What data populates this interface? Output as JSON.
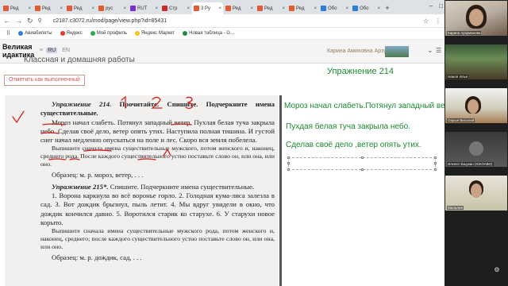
{
  "browser": {
    "tabs": [
      {
        "label": "Ред",
        "color": "#e25b35",
        "active": false
      },
      {
        "label": "Ред",
        "color": "#e25b35",
        "active": false
      },
      {
        "label": "Ред",
        "color": "#e25b35",
        "active": false
      },
      {
        "label": "рус",
        "color": "#e25b35",
        "active": false
      },
      {
        "label": "RUT",
        "color": "#7a2ecf",
        "active": false
      },
      {
        "label": "Стр",
        "color": "#cc2b2b",
        "active": false
      },
      {
        "label": "3 Ру",
        "color": "#e25b35",
        "active": true
      },
      {
        "label": "Ред",
        "color": "#e25b35",
        "active": false
      },
      {
        "label": "Ред",
        "color": "#e25b35",
        "active": false
      },
      {
        "label": "Ред",
        "color": "#e25b35",
        "active": false
      },
      {
        "label": "Обо",
        "color": "#2f7ed8",
        "active": false
      },
      {
        "label": "Обо",
        "color": "#2f7ed8",
        "active": false
      }
    ],
    "new_tab_label": "+",
    "url": "c2187.c3072.ru/mod/page/view.php?id=85431",
    "bookmarks": [
      {
        "label": "Авиабилеты",
        "color": "#2f7ed8"
      },
      {
        "label": "Яндекс",
        "color": "#e23b2b"
      },
      {
        "label": "Мой профиль",
        "color": "#2fa84f"
      },
      {
        "label": "Яндекс Маркет",
        "color": "#f5c518"
      },
      {
        "label": "Новая таблица - G...",
        "color": "#1e8e3e"
      }
    ]
  },
  "site": {
    "logo_line1": "Великая",
    "logo_line2": "идактика",
    "lang_ru": "RU",
    "lang_en": "EN",
    "partial_title": "Классная и домашняя работы",
    "user_name": "Карина Амиховна Арзуманова"
  },
  "page": {
    "mark_done_button": "Отметить как выполненный",
    "exercise_heading": "Упражнение 214"
  },
  "textbook": {
    "ex214_title": "Упражнение 214.",
    "ex214_instr": " Прочитайте. Спишите. Подчеркните имена существительные.",
    "ex214_text": "Мороз начал слабеть. Потянул западный ветер. Пухлая белая туча закрыла небо. Сделав своё дело, ветер опять утих. Наступила полная тишина. И густой снег начал медленно опускаться на поле и лес. Скоро вся земля побелела.",
    "ex214_task": "Выпишите сначала имена существительные мужского, потом женского и, наконец, среднего рода. После каждого существительного устно поставьте слово он, или она, или оно.",
    "ex214_sample": "Образец: м. р. мороз, ветер, . . .",
    "ex215_title": "Упражнение 215*.",
    "ex215_instr": " Спишите. Подчеркните имена существительные.",
    "ex215_text": "1. Ворона каркнула во всё воронье горло. 2. Голодная кума-лиса залезла в сад. 3. Вот дождик брызнул, пыль летит. 4. Мы вдруг увидели в окно, что дождик кончился давно. 5. Воротился старик ко старухе. 6. У старухи новое корыто.",
    "ex215_task": "Выпишите сначала имена существительные мужского рода, потом женского и, наконец, среднего; после каждого существительного устно поставьте слово он, или она, или оно.",
    "ex215_sample": "Образец: м. р. дождик, сад, . . ."
  },
  "answers": {
    "line1": "Мороз начал слабеть.Потянул западный ветер.",
    "line2": "Пухдая белая туча закрыла небо.",
    "line3": "Сделав своё дело ,ветер опять утих."
  },
  "participants": [
    {
      "name": "Карина Арзуманова"
    },
    {
      "name": "Наиля Илья"
    },
    {
      "name": "Оарыя Висилий"
    },
    {
      "name": "Иллесп Бшукан (ЮКЛАВО)"
    },
    {
      "name": "Малалия"
    }
  ],
  "colors": {
    "accent_green": "#1a8a30",
    "ink_red": "#d21f1f",
    "mark_done_red": "#c55"
  }
}
